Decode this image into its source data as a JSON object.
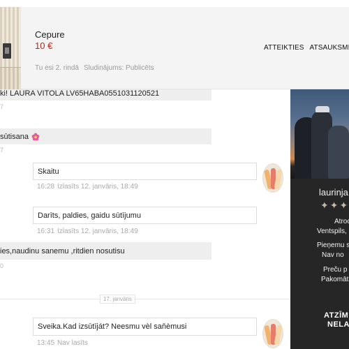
{
  "header": {
    "title": "Cepure",
    "price": "10 €",
    "queue_text": "Tu esi 2. rindā",
    "listing_status": "Sludinājums: Publicēts",
    "actions": [
      "ATTEIKTIES",
      "ATSAUKSMI"
    ]
  },
  "chat": {
    "messages": [
      {
        "text": "ki! LAURA VITOLA LV65HABA0551031120521",
        "time": "7"
      },
      {
        "text": "sūtisana",
        "time": "7"
      },
      {
        "text": "Skaitu",
        "time": "16:28",
        "status": "Izlasīts 12. janvāris, 18:49"
      },
      {
        "text": "Darīts, paldies, gaidu sūtījumu",
        "time": "16:31",
        "status": "Izlasīts 12. janvāris, 18:49"
      },
      {
        "text": "ies,naudinu sanemu ,ritdien nosutisu",
        "time": "0"
      },
      {
        "text": "Sveika.Kad izsūtīját? Neesmu vèl saňèmusi",
        "time": "13:45",
        "status": "Nav lasīts"
      }
    ],
    "date_divider": "17. janvāris"
  },
  "profile": {
    "name": "laurinja",
    "stars": "✦✦✦✦",
    "location_label": "Atroc",
    "location_value": "Ventspils, ",
    "pickup_label": "Pieņemu s",
    "pickup_value": "Nav no",
    "shipping_label": "Preču p",
    "shipping_value": "Pakomāt",
    "badge_line1": "ATZĪMI",
    "badge_line2": "NELA"
  },
  "colors": {
    "price": "#b3261e",
    "header_bg": "#f4f4f4",
    "incoming_bg": "#eeeeee",
    "profile_bg": "#262626"
  }
}
